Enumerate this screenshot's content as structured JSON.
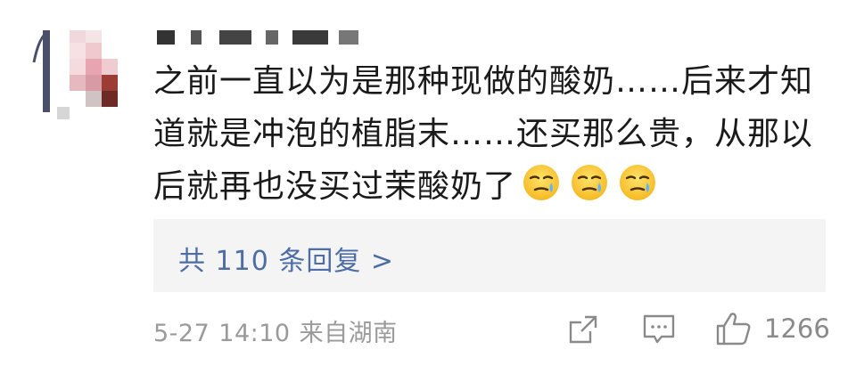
{
  "comment": {
    "username": "",
    "text": "之前一直以为是那种现做的酸奶……后来才知道就是冲泡的植脂末……还买那么贵，从那以后就再也没买过茉酸奶了",
    "emojis": [
      "sweat-face-icon",
      "sweat-face-icon",
      "sweat-face-icon"
    ]
  },
  "replies": {
    "label": "共 110 条回复 >"
  },
  "meta": {
    "date": "5-27",
    "time": "14:10",
    "source": "来自湖南"
  },
  "actions": {
    "share_icon": "share-icon",
    "comment_icon": "comment-icon",
    "like_icon": "thumbs-up-icon",
    "like_count": "1266"
  },
  "colors": {
    "link": "#4c6da6",
    "meta": "#9a9a9a",
    "reply_bg": "#f4f4f4"
  }
}
